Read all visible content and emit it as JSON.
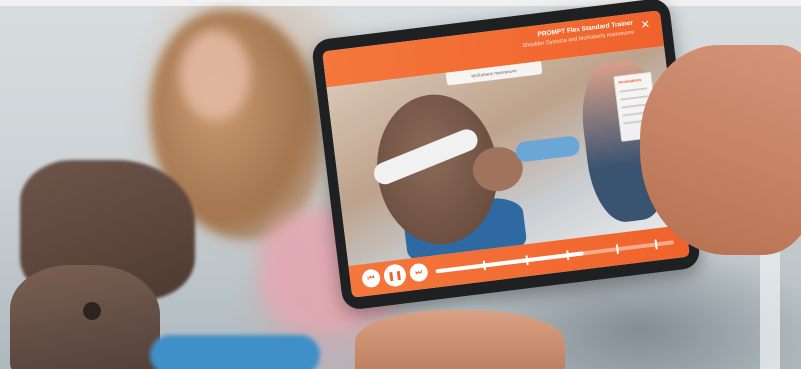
{
  "app": {
    "title": "PROMPT Flex Standard Trainer",
    "subtitle": "Shoulder Dystocia and McRoberts manoeuvre",
    "video_caption": "McRoberts manoeuvre",
    "annotations_title": "Annotations"
  },
  "controls": {
    "prev_icon": "skip-back-icon",
    "play_icon": "pause-icon",
    "next_icon": "skip-forward-icon",
    "prev_glyph": "⏮",
    "pause_glyph": "❚❚",
    "next_glyph": "⏭",
    "close_glyph": "✕",
    "progress_fraction": 0.62
  },
  "colors": {
    "accent": "#f0622c",
    "accent_light": "#f4773c"
  }
}
